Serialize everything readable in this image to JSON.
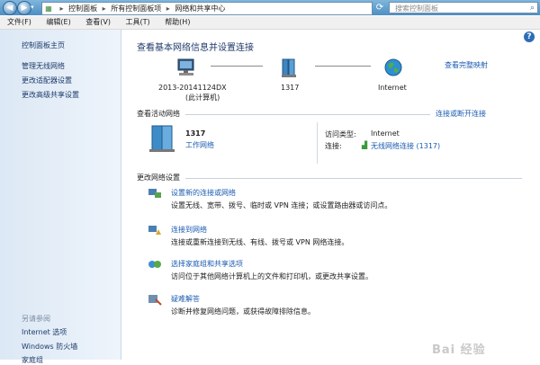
{
  "address": {
    "crumbs": [
      "控制面板",
      "所有控制面板项",
      "网络和共享中心"
    ],
    "search_placeholder": "搜索控制面板"
  },
  "menu": [
    "文件(F)",
    "编辑(E)",
    "查看(V)",
    "工具(T)",
    "帮助(H)"
  ],
  "sidebar": {
    "home": "控制面板主页",
    "links": [
      "管理无线网络",
      "更改适配器设置",
      "更改高级共享设置"
    ],
    "see_also_title": "另请参阅",
    "see_also": [
      "Internet 选项",
      "Windows 防火墙",
      "家庭组"
    ]
  },
  "main": {
    "title": "查看基本网络信息并设置连接",
    "full_map": "查看完整映射",
    "map": {
      "computer": "2013-20141124DX",
      "computer_sub": "(此计算机)",
      "network": "1317",
      "internet": "Internet"
    },
    "active_label": "查看活动网络",
    "connect_link": "连接或断开连接",
    "active_network": {
      "name": "1317",
      "type": "工作网络",
      "access_key": "访问类型:",
      "access_val": "Internet",
      "conn_key": "连接:",
      "conn_val": "无线网络连接 (1317)"
    },
    "change_label": "更改网络设置",
    "tasks": [
      {
        "title": "设置新的连接或网络",
        "desc": "设置无线、宽带、拨号、临时或 VPN 连接；或设置路由器或访问点。"
      },
      {
        "title": "连接到网络",
        "desc": "连接或重新连接到无线、有线、拨号或 VPN 网络连接。"
      },
      {
        "title": "选择家庭组和共享选项",
        "desc": "访问位于其他网络计算机上的文件和打印机，或更改共享设置。"
      },
      {
        "title": "疑难解答",
        "desc": "诊断并修复网络问题，或获得故障排除信息。"
      }
    ]
  },
  "watermark": "Bai 经验",
  "colors": {
    "link": "#1a5bb0",
    "sidebar_bg": "#dce8f5",
    "title": "#1e3a6a"
  }
}
